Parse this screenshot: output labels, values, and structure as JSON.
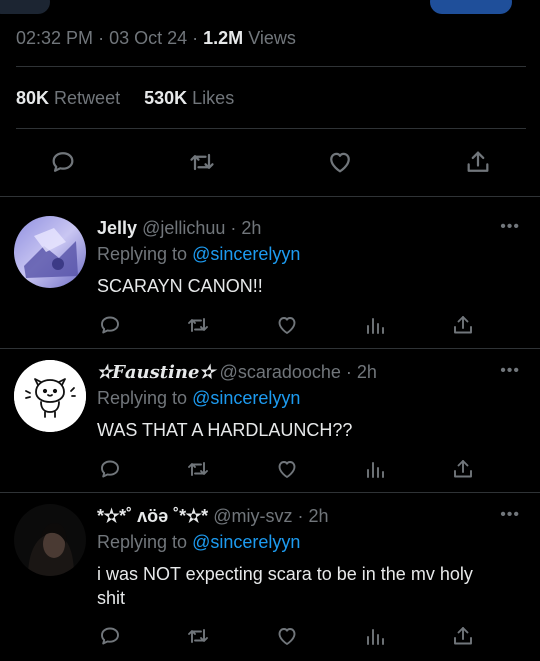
{
  "tweet": {
    "time": "02:32 PM",
    "date": "03 Oct 24",
    "views_count": "1.2M",
    "views_label": "Views",
    "retweets_count": "80K",
    "retweets_label": "Retweet",
    "likes_count": "530K",
    "likes_label": "Likes"
  },
  "replies": [
    {
      "name": "Jelly",
      "handle": "@jellichuu",
      "time": "2h",
      "replying_prefix": "Replying to",
      "replying_handle": "@sincerelyyn",
      "text": "SCARAYN CANON!!",
      "avatar_icon": "anime-avatar"
    },
    {
      "name": "✫𝑭𝒂𝒖𝒔𝒕𝒊𝒏𝒆✫",
      "handle": "@scaradooche",
      "time": "2h",
      "replying_prefix": "Replying to",
      "replying_handle": "@sincerelyyn",
      "text": "WAS THAT A HARDLAUNCH??",
      "avatar_icon": "cartoon-cat-avatar"
    },
    {
      "name": "*✫*˚ ʌöə ˚*✫*",
      "handle": "@miy-svz",
      "time": "2h",
      "replying_prefix": "Replying to",
      "replying_handle": "@sincerelyyn",
      "text": "i was NOT expecting scara to be in the mv holy shit",
      "avatar_icon": "photo-avatar"
    }
  ],
  "separator": "·",
  "more_glyph": "•••",
  "colors": {
    "accent": "#1d9bf0",
    "muted": "#71767b",
    "text": "#e7e9ea",
    "background": "#000000"
  }
}
